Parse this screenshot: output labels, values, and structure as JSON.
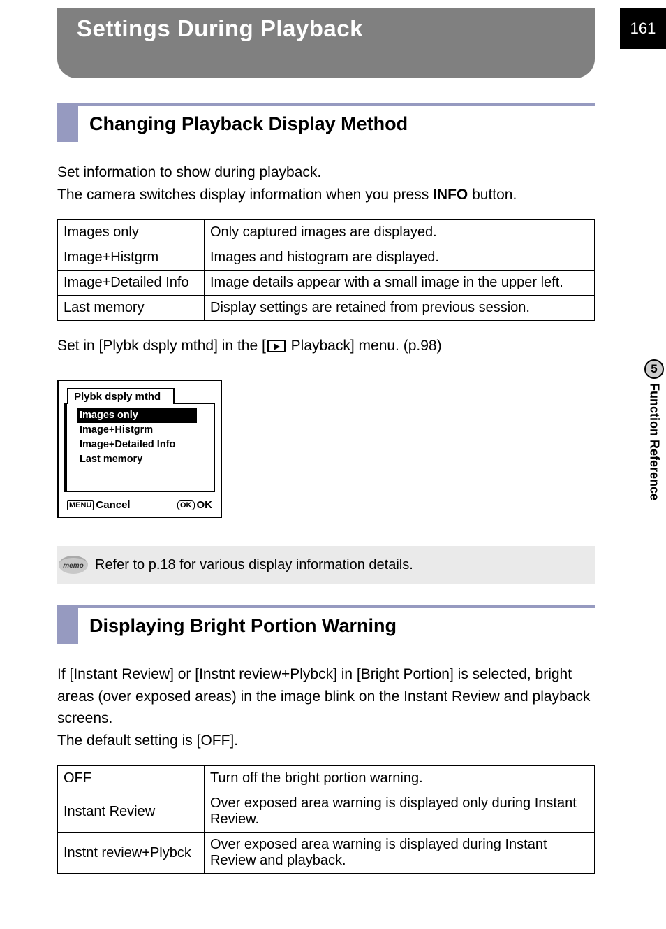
{
  "page_number": "161",
  "side_tab": {
    "number": "5",
    "label": "Function Reference"
  },
  "title": "Settings During Playback",
  "section1": {
    "heading": "Changing Playback Display Method",
    "intro_line1": "Set information to show during playback.",
    "intro_line2_pre": "The camera switches display information when you press ",
    "intro_line2_info": "INFO",
    "intro_line2_post": " button.",
    "rows": [
      {
        "name": "Images only",
        "desc": "Only captured images are displayed."
      },
      {
        "name": "Image+Histgrm",
        "desc": "Images and histogram are displayed."
      },
      {
        "name": "Image+Detailed Info",
        "desc": "Image details appear with a small image in the upper left."
      },
      {
        "name": "Last memory",
        "desc": "Display settings are retained from previous session."
      }
    ],
    "setin_pre": "Set in [Plybk dsply mthd] in the [",
    "setin_post": " Playback] menu. (p.98)",
    "lcd": {
      "tab": "Plybk dsply mthd",
      "items": [
        "Images only",
        "Image+Histgrm",
        "Image+Detailed Info",
        "Last memory"
      ],
      "cancel": "Cancel",
      "ok": "OK",
      "menu_label": "MENU",
      "ok_label": "OK"
    },
    "memo": "Refer to p.18 for various display information details."
  },
  "section2": {
    "heading": "Displaying Bright Portion Warning",
    "intro": "If [Instant Review] or [Instnt review+Plybck] in [Bright Portion] is selected, bright areas (over exposed areas) in the image blink on the Instant Review and playback screens.",
    "default": "The default setting is [OFF].",
    "rows": [
      {
        "name": "OFF",
        "desc": "Turn off the bright portion warning."
      },
      {
        "name": "Instant Review",
        "desc": "Over exposed area warning is displayed only during Instant Review."
      },
      {
        "name": "Instnt review+Plybck",
        "desc": "Over exposed area warning is displayed during Instant Review and playback."
      }
    ]
  }
}
